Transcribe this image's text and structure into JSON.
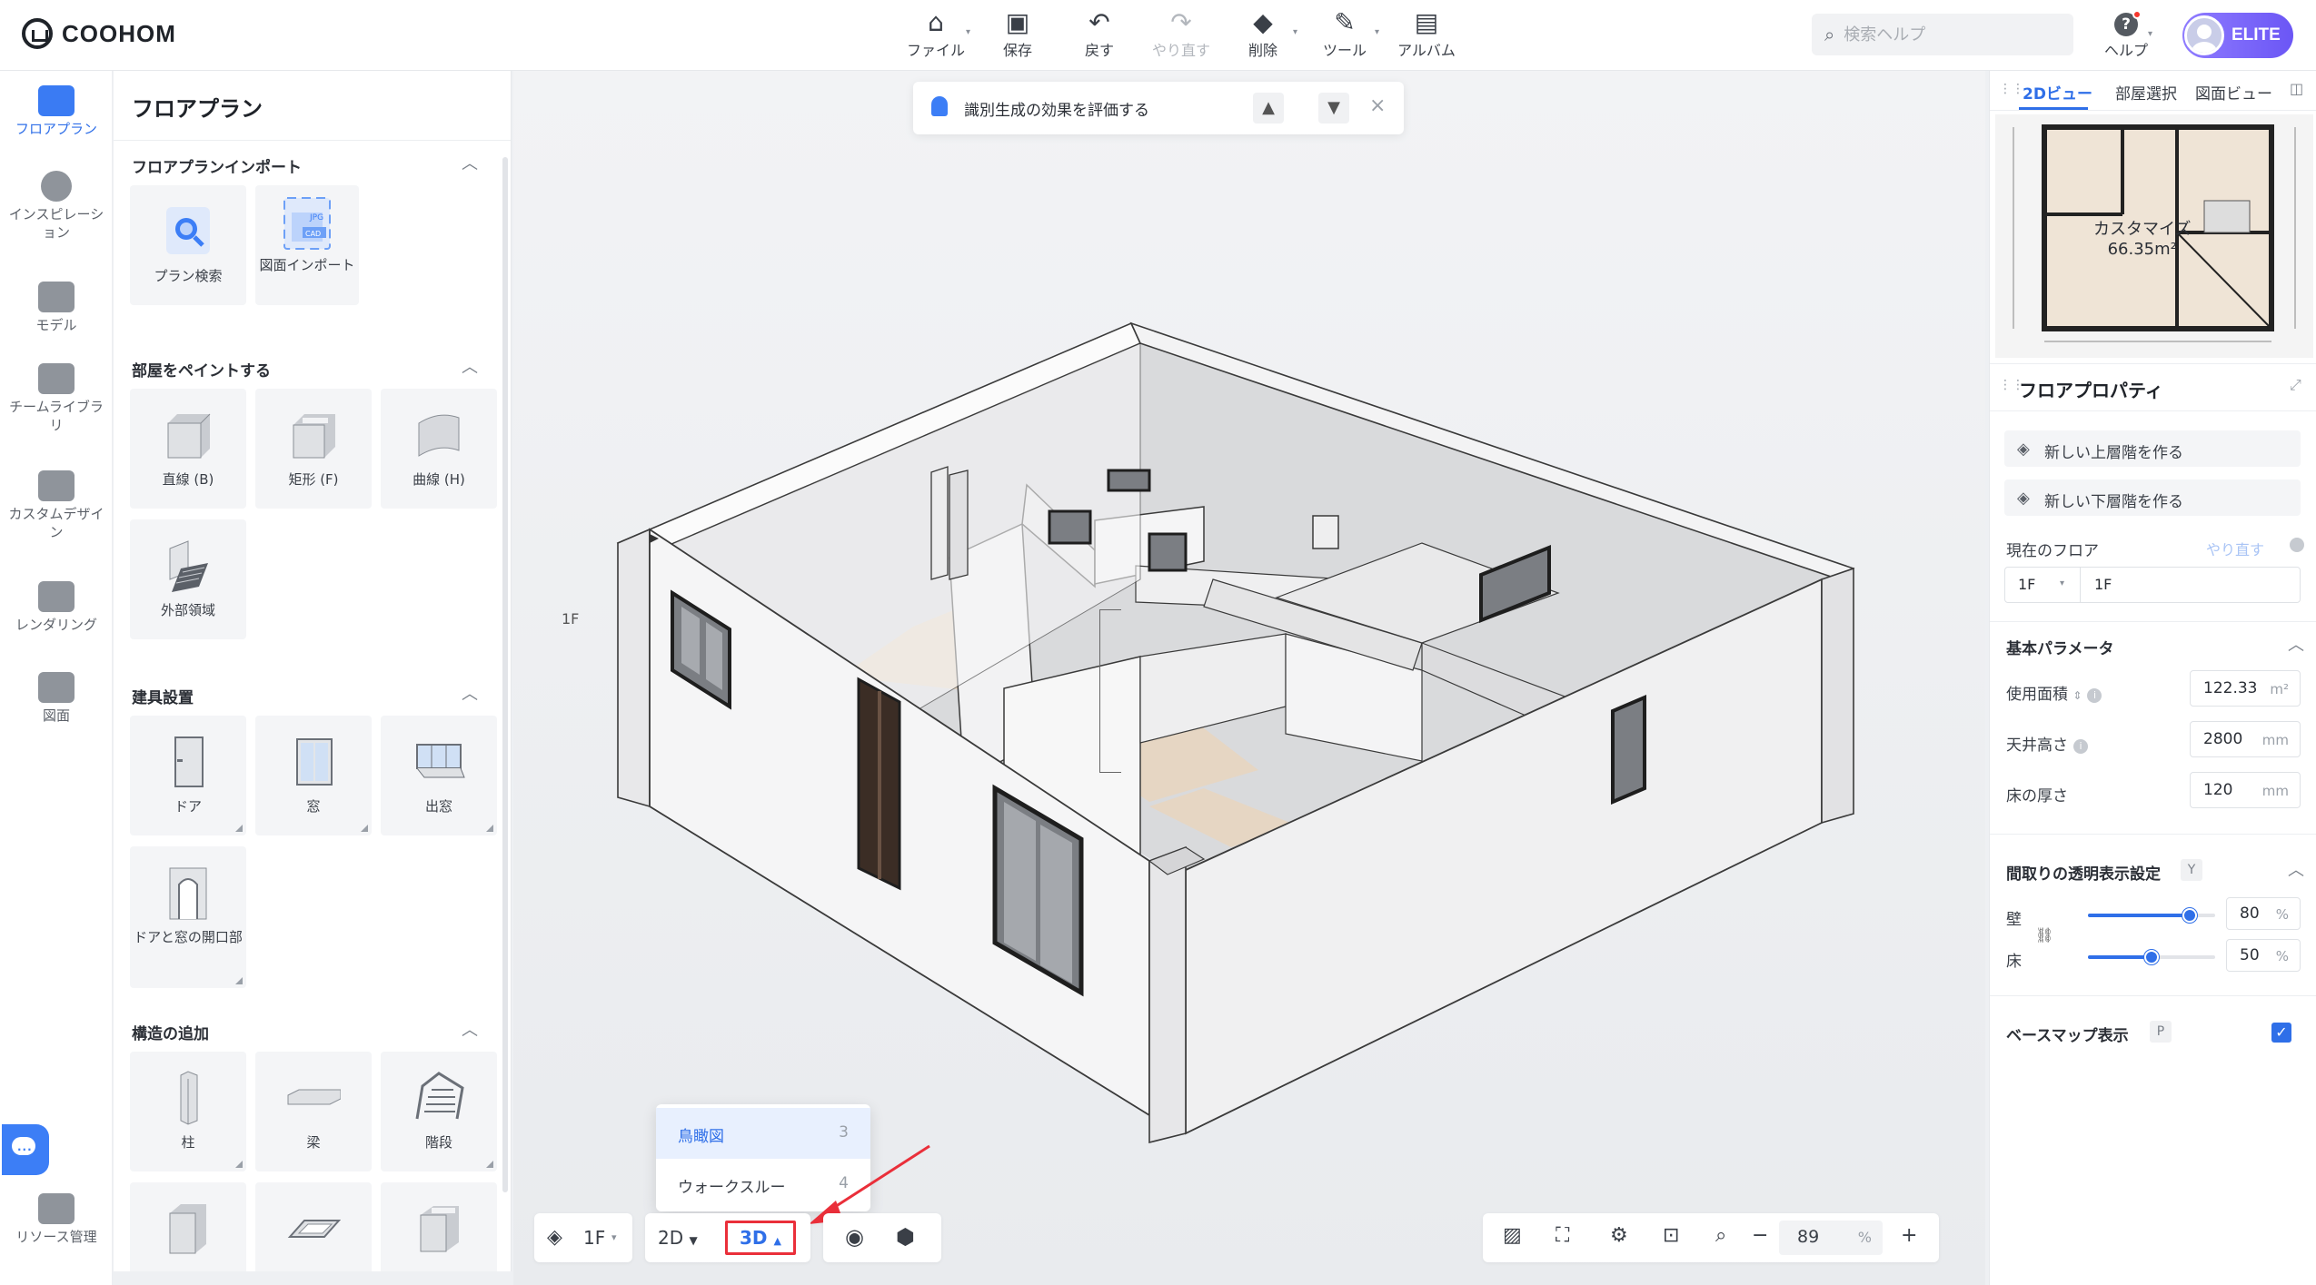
{
  "brand": {
    "name": "COOHOM"
  },
  "toolbar": [
    {
      "label": "ファイル",
      "icon": "file-icon",
      "caret": true
    },
    {
      "label": "保存",
      "icon": "save-icon",
      "caret": false
    },
    {
      "label": "戻す",
      "icon": "undo-icon",
      "caret": false
    },
    {
      "label": "やり直す",
      "icon": "redo-icon",
      "caret": false,
      "disabled": true
    },
    {
      "label": "削除",
      "icon": "eraser-icon",
      "caret": true
    },
    {
      "label": "ツール",
      "icon": "wrench-icon",
      "caret": true
    },
    {
      "label": "アルバム",
      "icon": "album-icon",
      "caret": false
    }
  ],
  "search": {
    "placeholder": "検索ヘルプ"
  },
  "help": {
    "label": "ヘルプ"
  },
  "account": {
    "badge": "ELITE"
  },
  "rail": [
    {
      "label": "フロアプラン",
      "active": true
    },
    {
      "label": "インスピレーション"
    },
    {
      "label": "モデル"
    },
    {
      "label": "チームライブラリ"
    },
    {
      "label": "カスタムデザイン"
    },
    {
      "label": "レンダリング"
    },
    {
      "label": "図面"
    },
    {
      "label": "リソース管理"
    }
  ],
  "panel": {
    "title": "フロアプラン",
    "sections": [
      {
        "title": "フロアプランインポート",
        "items": [
          "プラン検索",
          "図面インポート"
        ]
      },
      {
        "title": "部屋をペイントする",
        "items": [
          "直線 (B)",
          "矩形 (F)",
          "曲線 (H)",
          "外部領域"
        ]
      },
      {
        "title": "建具設置",
        "items": [
          "ドア",
          "窓",
          "出窓",
          "ドアと窓の開口部"
        ]
      },
      {
        "title": "構造の追加",
        "items": [
          "柱",
          "梁",
          "階段",
          "",
          "",
          ""
        ]
      }
    ]
  },
  "canvas": {
    "notification": "識別生成の効果を評価する",
    "floor_label": "1F",
    "floor_selector": "1F",
    "view_2d": "2D",
    "view_3d": "3D",
    "dropdown": [
      {
        "label": "鳥瞰図",
        "key": "3",
        "selected": true
      },
      {
        "label": "ウォークスルー",
        "key": "4"
      }
    ],
    "zoom": "89",
    "zoom_unit": "%"
  },
  "right_panel": {
    "tabs": [
      "2Dビュー",
      "部屋選択",
      "図面ビュー"
    ],
    "minimap_label": "カスタマイズ",
    "minimap_area": "66.35m²",
    "title": "フロアプロパティ",
    "buttons": [
      "新しい上層階を作る",
      "新しい下層階を作る"
    ],
    "current_floor_label": "現在のフロア",
    "redo_label": "やり直す",
    "current_floor_select": "1F",
    "current_floor_name": "1F",
    "basic_params_title": "基本パラメータ",
    "usage_area_label": "使用面積",
    "usage_area_value": "122.33",
    "usage_area_unit": "m²",
    "ceiling_label": "天井高さ",
    "ceiling_value": "2800",
    "ceiling_unit": "mm",
    "floor_thickness_label": "床の厚さ",
    "floor_thickness_value": "120",
    "floor_thickness_unit": "mm",
    "transparency_title": "間取りの透明表示設定",
    "transparency_key": "Y",
    "wall_label": "壁",
    "wall_value": "80",
    "wall_level": 0.8,
    "floor_label": "床",
    "floor_value": "50",
    "floor_level": 0.5,
    "percent": "%",
    "basemap_label": "ベースマップ表示",
    "basemap_key": "P",
    "basemap_checked": true
  },
  "colors": {
    "accent": "#2f6fe8",
    "highlight_red": "#ea2f3a",
    "elite": "#7b68f7"
  }
}
